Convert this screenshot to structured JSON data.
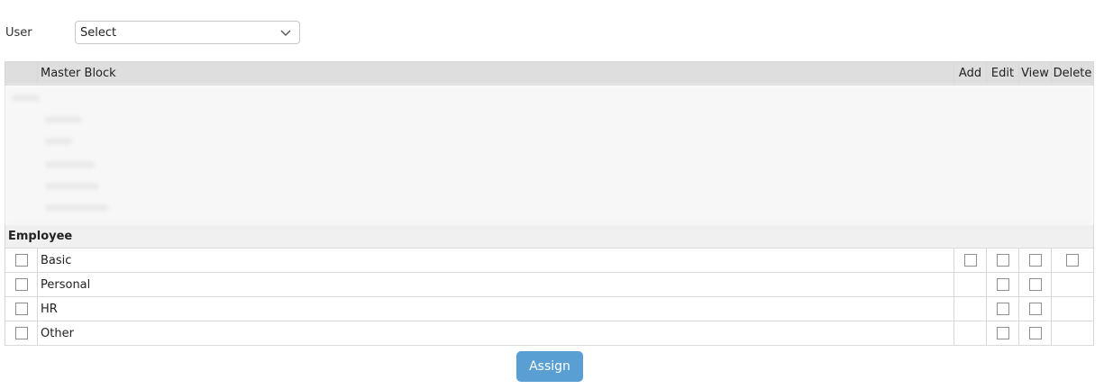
{
  "user": {
    "label": "User",
    "select_value": "Select"
  },
  "table": {
    "headers": {
      "name": "Master Block",
      "add": "Add",
      "edit": "Edit",
      "view": "View",
      "delete": "Delete"
    },
    "section": "Employee",
    "rows": [
      {
        "name": "Basic",
        "add": true,
        "edit": true,
        "view": true,
        "delete": true
      },
      {
        "name": "Personal",
        "add": false,
        "edit": true,
        "view": true,
        "delete": false
      },
      {
        "name": "HR",
        "add": false,
        "edit": true,
        "view": true,
        "delete": false
      },
      {
        "name": "Other",
        "add": false,
        "edit": true,
        "view": true,
        "delete": false
      }
    ]
  },
  "actions": {
    "assign_label": "Assign"
  },
  "colors": {
    "assign_button": "#5a9fd4",
    "header_bg": "#dedede"
  }
}
